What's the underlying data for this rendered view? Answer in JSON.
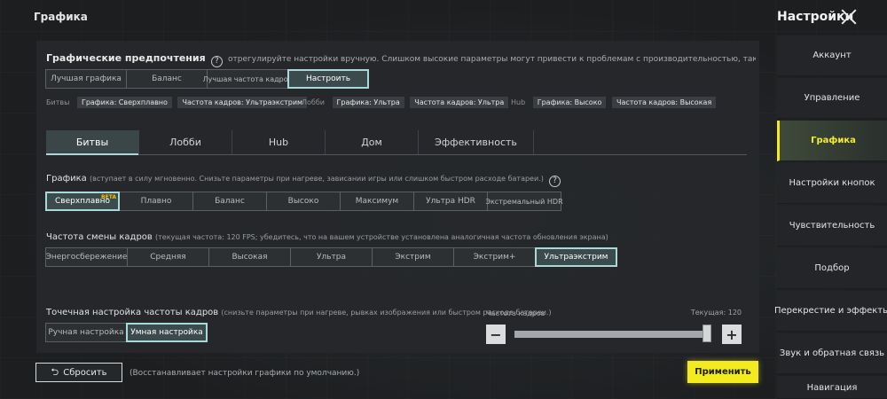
{
  "header": {
    "title": "Графика",
    "settings_title": "Настройки"
  },
  "preferences": {
    "title": "Графические предпочтения",
    "help": "?",
    "description": "отрегулируйте настройки вручную. Слишком высокие параметры могут привести к проблемам с производительностью, такими как перегрев, быстрый разряд батареи или повр",
    "options": [
      "Лучшая графика",
      "Баланс",
      "Лучшая частота кадров",
      "Настроить"
    ],
    "selected": "Настроить"
  },
  "presets": [
    {
      "label": "Битвы",
      "graphics": "Графика: Сверхплавно",
      "fps": "Частота кадров: Ультраэкстрим"
    },
    {
      "label": "Лобби",
      "graphics": "Графика: Ультра",
      "fps": "Частота кадров: Ультра"
    },
    {
      "label": "Hub",
      "graphics": "Графика: Высоко",
      "fps": "Частота кадров: Высокая"
    }
  ],
  "tabs": [
    "Битвы",
    "Лобби",
    "Hub",
    "Дом",
    "Эффективность"
  ],
  "active_tab": "Битвы",
  "graphics": {
    "label": "Графика",
    "note": "(вступает в силу мгновенно. Снизьте параметры при нагреве, зависании игры или слишком быстром расходе батареи.)",
    "help": "?",
    "badge": "BETA",
    "options": [
      "Сверхплавно",
      "Плавно",
      "Баланс",
      "Высоко",
      "Максимум",
      "Ультра HDR",
      "Экстремальный HDR"
    ],
    "selected": "Сверхплавно"
  },
  "fps": {
    "label": "Частота смены кадров",
    "note": "(текущая частота: 120 FPS; убедитесь, что на вашем устройстве установлена аналогичная частота обновления экрана)",
    "options": [
      "Энергосбережение",
      "Средняя",
      "Высокая",
      "Ультра",
      "Экстрим",
      "Экстрим+",
      "Ультраэкстрим"
    ],
    "selected": "Ультраэкстрим"
  },
  "fine_tune": {
    "label": "Точечная настройка частоты кадров",
    "note": "(снизьте параметры при нагреве, рывках изображения или быстром расходе батареи.)",
    "options": [
      "Ручная настройка",
      "Умная настройка"
    ],
    "selected": "Умная настройка",
    "slider_label": "Частота кадров",
    "current": "Текущая: 120",
    "slider_fraction": 1.0,
    "minus": "−",
    "plus": "+"
  },
  "footer": {
    "reset_label": "Сбросить",
    "reset_desc": "(Восстанавливает настройки графики по умолчанию.)",
    "apply_label": "Применить"
  },
  "sidebar": {
    "items": [
      "Аккаунт",
      "Управление",
      "Графика",
      "Настройки кнопок",
      "Чувствительность",
      "Подбор",
      "Перекрестие и эффекты",
      "Звук и обратная связь",
      "Навигация"
    ],
    "active": "Графика"
  },
  "colors": {
    "accent": "#a9d8d8",
    "apply": "#f3ea20",
    "beta": "#f3c400"
  }
}
